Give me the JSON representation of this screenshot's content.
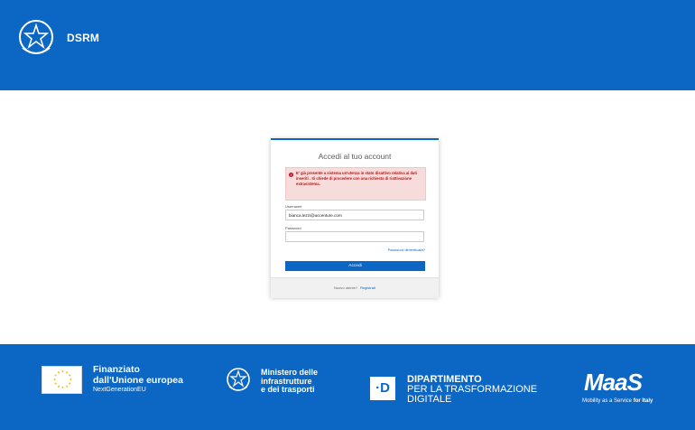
{
  "header": {
    "app_title": "DSRM",
    "emblem_icon": "italian-republic-emblem-icon"
  },
  "login": {
    "title": "Accedi al tuo account",
    "alert_text": "E' già presente a sistema un'utenza in stato disattivo relativa ai dati inseriti . Si chiede di procedere con una richiesta di riattivazione extrasistema.",
    "username_label": "Username",
    "username_value": "bianca.lezzi@accenture.com",
    "password_label": "Password",
    "password_value": "",
    "forgot_password": "Password dimenticata?",
    "submit_label": "Accedi",
    "new_user_prompt": "Nuovo utente?",
    "register_link": "Registrati"
  },
  "footer": {
    "eu_line1": "Finanziato",
    "eu_line2": "dall'Unione europea",
    "eu_line3": "NextGenerationEU",
    "mit_line1": "Ministero delle",
    "mit_line2": "infrastrutture",
    "mit_line3": "e dei trasporti",
    "dtd_mark": "·D",
    "dtd_line1": "DIPARTIMENTO",
    "dtd_line2": "PER LA TRASFORMAZIONE",
    "dtd_line3": "DIGITALE",
    "maas_logo": "MaaS",
    "maas_tag_prefix": "Mobility as a Service",
    "maas_tag_suffix": "for Italy"
  },
  "colors": {
    "primary": "#0b66c4",
    "alert_bg": "#f7dcdc",
    "alert_text": "#b11b1b"
  }
}
